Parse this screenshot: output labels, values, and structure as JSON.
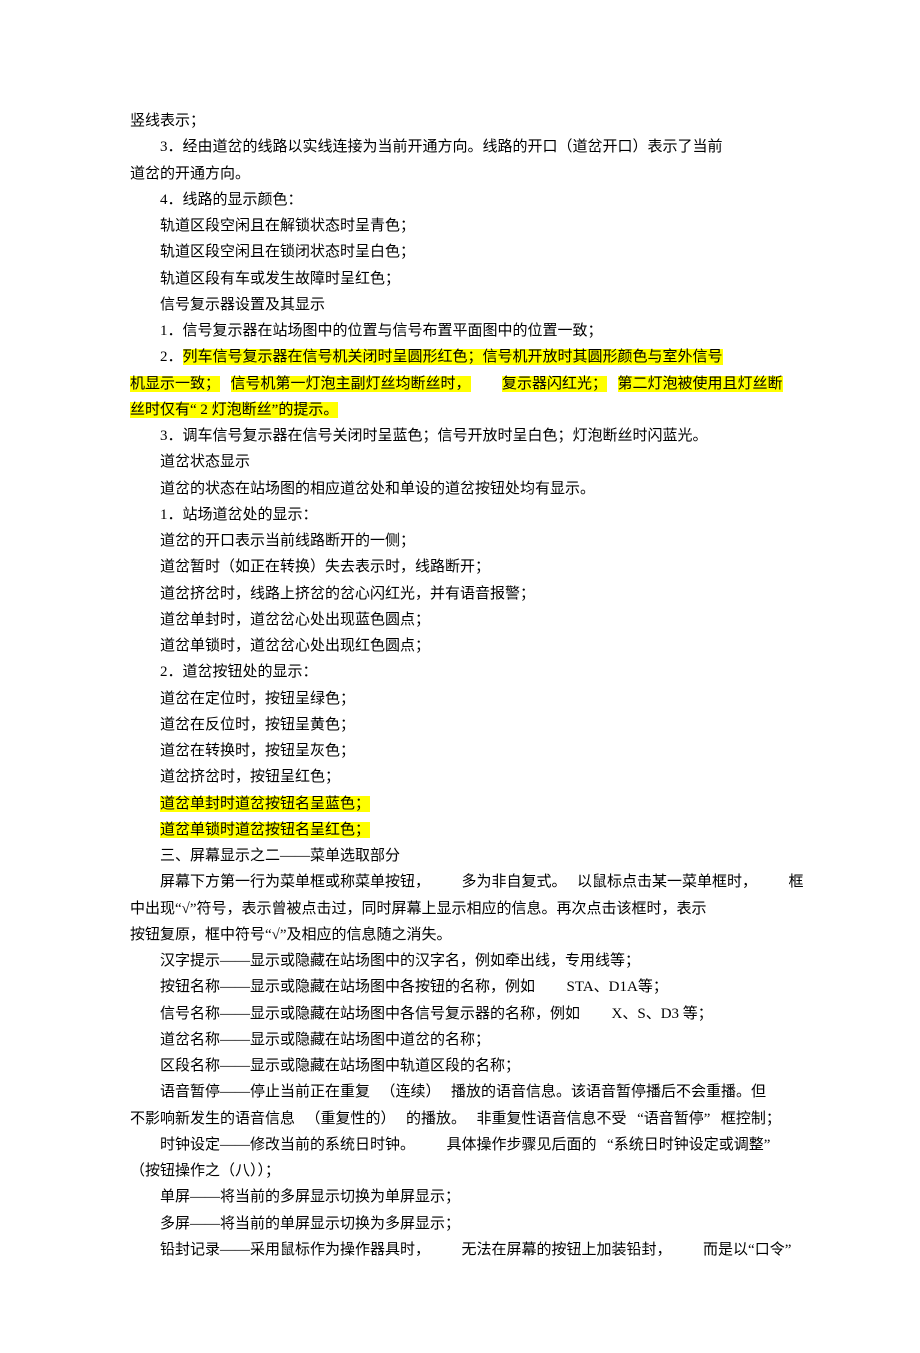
{
  "lines": {
    "l1": "竖线表示；",
    "l2": "3．经由道岔的线路以实线连接为当前开通方向。线路的开口（道岔开口）表示了当前",
    "l3": "道岔的开通方向。",
    "l4": "4．线路的显示颜色：",
    "l5": "轨道区段空闲且在解锁状态时呈青色；",
    "l6": "轨道区段空闲且在锁闭状态时呈白色；",
    "l7": "轨道区段有车或发生故障时呈红色；",
    "l8": "信号复示器设置及其显示",
    "l9": "1．信号复示器在站场图中的位置与信号布置平面图中的位置一致；",
    "l10a": "2．",
    "l10b": "列车信号复示器在信号机关闭时呈圆形红色；信号机开放时其圆形颜色与室外信号",
    "l11a": "机显示一致；",
    "l11b": "信号机第一灯泡主副灯丝均断丝时，",
    "l11c": "复示器闪红光；",
    "l11d": "第二灯泡被使用且灯丝断",
    "l12": "丝时仅有“ 2 灯泡断丝”的提示。",
    "l13": "3．调车信号复示器在信号关闭时呈蓝色；信号开放时呈白色；灯泡断丝时闪蓝光。",
    "l14": "道岔状态显示",
    "l15": "道岔的状态在站场图的相应道岔处和单设的道岔按钮处均有显示。",
    "l16": "1．站场道岔处的显示：",
    "l17": "道岔的开口表示当前线路断开的一侧；",
    "l18": "道岔暂时（如正在转换）失去表示时，线路断开；",
    "l19": "道岔挤岔时，线路上挤岔的岔心闪红光，并有语音报警；",
    "l20": "道岔单封时，道岔岔心处出现蓝色圆点；",
    "l21": "道岔单锁时，道岔岔心处出现红色圆点；",
    "l22": "2．道岔按钮处的显示：",
    "l23": "道岔在定位时，按钮呈绿色；",
    "l24": "道岔在反位时，按钮呈黄色；",
    "l25": "道岔在转换时，按钮呈灰色；",
    "l26": "道岔挤岔时，按钮呈红色；",
    "l27": "道岔单封时道岔按钮名呈蓝色；",
    "l28": "道岔单锁时道岔按钮名呈红色；",
    "l29": "三、屏幕显示之二——菜单选取部分",
    "l30a": "屏幕下方第一行为菜单框或称菜单按钮，",
    "l30b": "多为非自复式。",
    "l30c": "以鼠标点击某一菜单框时，",
    "l30d": "框",
    "l31": "中出现“√”符号，表示曾被点击过，同时屏幕上显示相应的信息。再次点击该框时，表示",
    "l32": "按钮复原，框中符号“√”及相应的信息随之消失。",
    "l33": "汉字提示——显示或隐藏在站场图中的汉字名，例如牵出线，专用线等；",
    "l34a": "按钮名称——显示或隐藏在站场图中各按钮的名称，例如",
    "l34b": "STA、D1A等；",
    "l35a": "信号名称——显示或隐藏在站场图中各信号复示器的名称，例如",
    "l35b": "X、S、D3 等；",
    "l36": "道岔名称——显示或隐藏在站场图中道岔的名称；",
    "l37": "区段名称——显示或隐藏在站场图中轨道区段的名称；",
    "l38a": "语音暂停——停止当前正在重复",
    "l38b": "（连续）",
    "l38c": "播放的语音信息。该语音暂停播后不会重播。但",
    "l39a": "不影响新发生的语音信息",
    "l39b": "（重复性的）",
    "l39c": "的播放。",
    "l39d": "非重复性语音信息不受",
    "l39e": "“语音暂停”",
    "l39f": "框控制；",
    "l40a": "时钟设定——修改当前的系统日时钟。",
    "l40b": "具体操作步骤见后面的",
    "l40c": "“系统日时钟设定或调整”",
    "l41": "（按钮操作之（八））；",
    "l42": "单屏——将当前的多屏显示切换为单屏显示；",
    "l43": "多屏——将当前的单屏显示切换为多屏显示；",
    "l44a": "铅封记录——采用鼠标作为操作器具时，",
    "l44b": "无法在屏幕的按钮上加装铅封，",
    "l44c": "而是以“口令”"
  }
}
